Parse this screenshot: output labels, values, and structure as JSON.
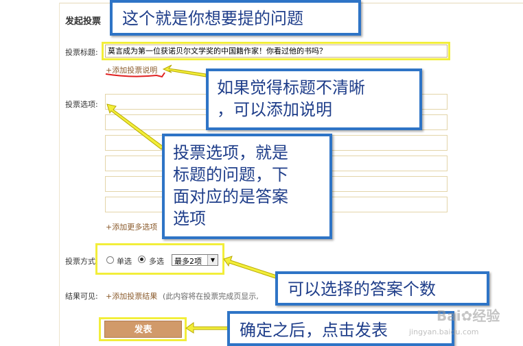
{
  "form": {
    "heading": "发起投票",
    "title_label": "投票标题:",
    "title_value": "莫言成为第一位获诺贝尔文学奖的中国籍作家！你看过他的书吗？",
    "add_description_link": "+添加投票说明",
    "options_label": "投票选项:",
    "add_more_options_link": "+添加更多选项",
    "method_label": "投票方式:",
    "single_choice_label": "单选",
    "multi_choice_label": "多选",
    "max_select_value": "最多2项",
    "results_label": "结果可见:",
    "add_results_link": "+添加投票结果",
    "results_note": "(此内容将在投票完成页显示,",
    "submit_label": "发表"
  },
  "callouts": {
    "title_note": "这个就是你想要提的问题",
    "description_note": [
      "如果觉得标题不清晰",
      "，可以添加说明"
    ],
    "options_note": [
      "投票选项，就是",
      "标题的问题，下",
      "面对应的是答案",
      "选项"
    ],
    "count_note": "可以选择的答案个数",
    "submit_note": "确定之后，点击发表"
  },
  "watermark": {
    "brand": "Bai",
    "brand_tail": "经验",
    "url": "jingyan.baidu.com"
  },
  "colors": {
    "callout_border": "#2e74c6",
    "callout_text": "#1f3e8a",
    "highlight": "#f2ee3a",
    "submit_button": "#d19a6a",
    "link": "#8a5a2b"
  }
}
